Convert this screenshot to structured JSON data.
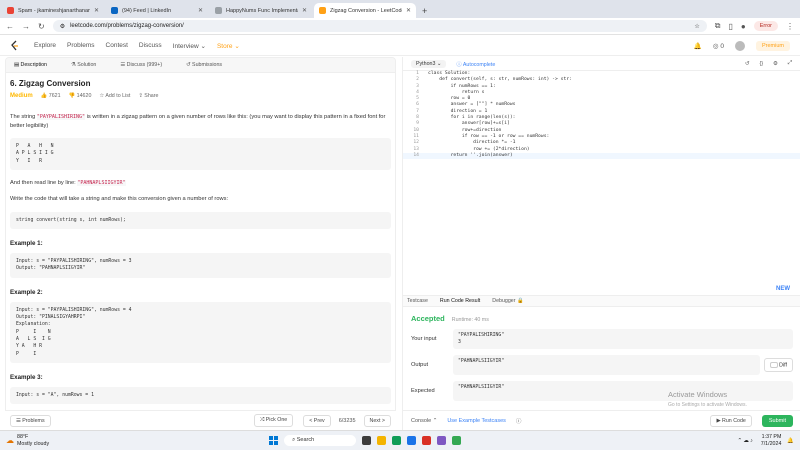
{
  "browser": {
    "tabs": [
      {
        "title": "Spam - jkamineshjanarthanan",
        "color": "#ea4335"
      },
      {
        "title": "(94) Feed | LinkedIn",
        "color": "#0a66c2"
      },
      {
        "title": "HappyNums Func Implementati",
        "color": "#9aa0a6"
      },
      {
        "title": "Zigzag Conversion - LeetCode",
        "color": "#ffa116"
      }
    ],
    "url": "leetcode.com/problems/zigzag-conversion/",
    "error_label": "Error"
  },
  "lc_nav": {
    "links": [
      "Explore",
      "Problems",
      "Contest",
      "Discuss",
      "Interview",
      "Store"
    ],
    "coins": "0",
    "premium": "Premium"
  },
  "left_tabs": [
    "Description",
    "Solution",
    "Discuss (999+)",
    "Submissions"
  ],
  "problem": {
    "title": "6. Zigzag Conversion",
    "difficulty": "Medium",
    "likes": "7621",
    "dislikes": "14620",
    "add_to_list": "Add to List",
    "share": "Share",
    "para1_a": "The string ",
    "para1_code": "\"PAYPALISHIRING\"",
    "para1_b": " is written in a zigzag pattern on a given number of rows like this: (you may want to display this pattern in a fixed font for better legibility)",
    "zigzag": "P   A   H   N\nA P L S I I G\nY   I   R",
    "para2_a": "And then read line by line: ",
    "para2_code": "\"PAHNAPLSIIGYIR\"",
    "para3": "Write the code that will take a string and make this conversion given a number of rows:",
    "signature": "string convert(string s, int numRows);",
    "examples": [
      {
        "title": "Example 1:",
        "body": "Input: s = \"PAYPALISHIRING\", numRows = 3\nOutput: \"PAHNAPLSIIGYIR\""
      },
      {
        "title": "Example 2:",
        "body": "Input: s = \"PAYPALISHIRING\", numRows = 4\nOutput: \"PINALSIGYAHRPI\"\nExplanation:\nP     I    N\nA   L S  I G\nY A   H R\nP     I"
      },
      {
        "title": "Example 3:",
        "body": "Input: s = \"A\", numRows = 1"
      }
    ]
  },
  "left_bar": {
    "problems": "Problems",
    "pick_one": "Pick One",
    "prev": "< Prev",
    "page": "6/3235",
    "next": "Next >"
  },
  "editor": {
    "language": "Python3",
    "autocomplete": "Autocomplete",
    "lines": [
      "class Solution:",
      "    def convert(self, s: str, numRows: int) -> str:",
      "        if numRows == 1:",
      "            return s",
      "        row = 0",
      "        answer = [\"\"] * numRows",
      "        direction = 1",
      "        for i in range(len(s)):",
      "            answer[row]+=s[i]",
      "            row+=direction",
      "            if row == -1 or row == numRows:",
      "                direction *= -1",
      "                row += (2*direction)",
      "        return ''.join(answer)"
    ],
    "new_badge": "NEW"
  },
  "result_tabs": [
    "Testcase",
    "Run Code Result",
    "Debugger"
  ],
  "result": {
    "status": "Accepted",
    "runtime": "Runtime: 40 ms",
    "your_input_label": "Your input",
    "your_input": "\"PAYPALISHIRING\"\n3",
    "output_label": "Output",
    "output": "\"PAHNAPLSIIGYIR\"",
    "expected_label": "Expected",
    "expected": "\"PAHNAPLSIIGYIR\"",
    "diff": "Diff"
  },
  "watermark": {
    "line1": "Activate Windows",
    "line2": "Go to Settings to activate Windows."
  },
  "right_bar": {
    "console": "Console",
    "use_example": "Use Example Testcases",
    "run_code": "Run Code",
    "submit": "Submit"
  },
  "taskbar": {
    "temp": "88°F",
    "weather": "Mostly cloudy",
    "search": "Search",
    "time": "1:37 PM",
    "date": "7/1/2024"
  }
}
